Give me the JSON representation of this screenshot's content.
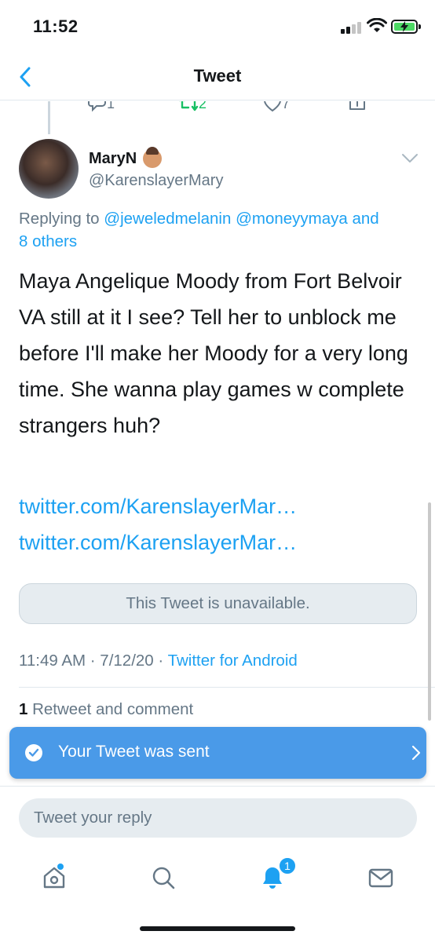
{
  "status_bar": {
    "time": "11:52"
  },
  "nav": {
    "title": "Tweet"
  },
  "parent_tweet": {
    "reply_count": "1",
    "retweet_count": "2",
    "like_count": "7"
  },
  "tweet": {
    "display_name": "MaryN",
    "handle": "@KarenslayerMary",
    "replying_prefix": "Replying to ",
    "replying_users": "@jeweledmelanin @moneyymaya",
    "replying_and": " and",
    "replying_others": "8 others",
    "text": "Maya Angelique Moody from Fort Belvoir VA still at it I see? Tell her to unblock me before I'll make her Moody for a very long time. She wanna play games w complete strangers huh?",
    "links": [
      "twitter.com/KarenslayerMar…",
      "twitter.com/KarenslayerMar…"
    ],
    "quoted_unavailable": "This Tweet is unavailable.",
    "timestamp": "11:49 AM · 7/12/20 · ",
    "source": "Twitter for Android",
    "retweet_count": "1",
    "retweet_label": " Retweet and comment"
  },
  "toast": {
    "text": "Your Tweet was sent"
  },
  "reply": {
    "placeholder": "Tweet your reply"
  },
  "tabbar": {
    "notifications_badge": "1"
  },
  "colors": {
    "accent": "#1da1f2",
    "toast": "#4a9ae8",
    "retweet_green": "#17bf63"
  },
  "icons": [
    "back-chevron-icon",
    "reply-icon",
    "retweet-icon",
    "like-icon",
    "share-icon",
    "chevron-down-icon",
    "check-icon",
    "chevron-right-icon",
    "home-icon",
    "search-icon",
    "notifications-icon",
    "messages-icon"
  ]
}
